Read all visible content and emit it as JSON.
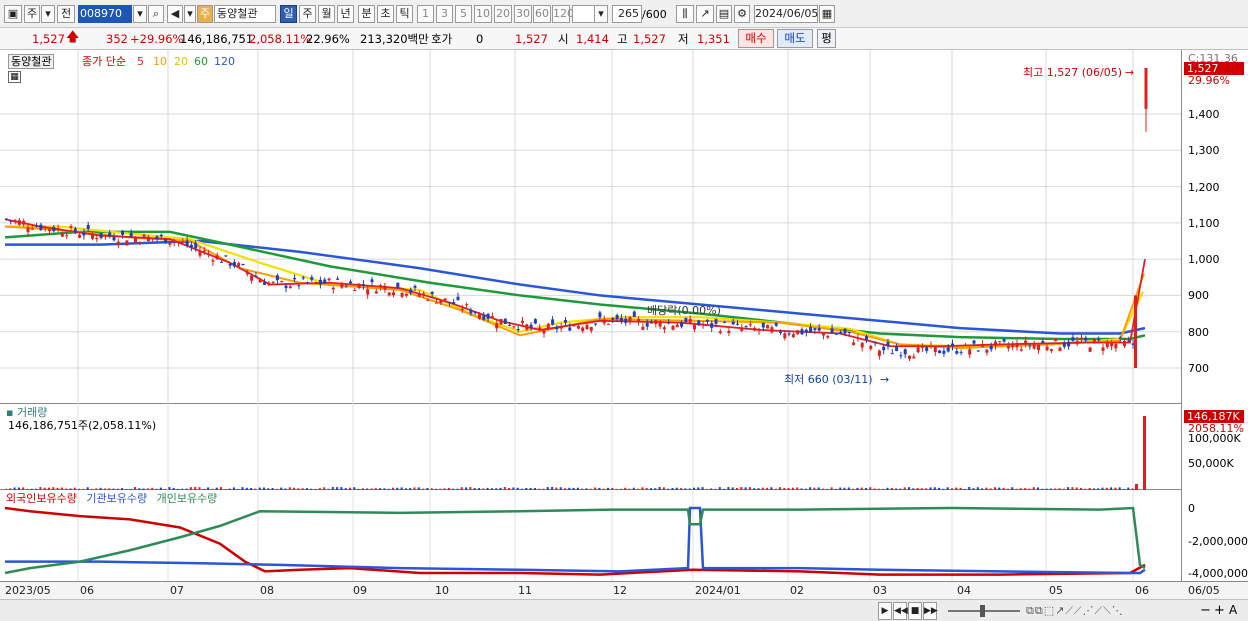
{
  "toolbar": {
    "mode1": "주",
    "mode2": "전",
    "code": "008970",
    "market_badge": "주",
    "name": "동양철관",
    "periods": [
      "일",
      "주",
      "월",
      "년",
      "분",
      "초",
      "틱"
    ],
    "intervals": [
      "1",
      "3",
      "5",
      "10",
      "20",
      "30",
      "60",
      "120"
    ],
    "count": "265",
    "count_max": "/600",
    "date": "2024/06/05"
  },
  "infobar": {
    "price": "1,527",
    "change": "352",
    "change_pct": "+29.96%",
    "volume": "146,186,751",
    "volume_ratio": "2,058.11%",
    "turnover": "22.96%",
    "amount": "213,320백만",
    "hoga_label": "호가",
    "hoga_value": "0",
    "hoga_price": "1,527",
    "open_label": "시",
    "open": "1,414",
    "high_label": "고",
    "high": "1,527",
    "low_label": "저",
    "low": "1,351",
    "buy": "매수",
    "sell": "매도",
    "eval": "평"
  },
  "price_pane": {
    "legend_name": "동양철관",
    "legend_title": "종가 단순",
    "ma": [
      {
        "label": "5",
        "color": "#e02020"
      },
      {
        "label": "10",
        "color": "#ff9c00"
      },
      {
        "label": "20",
        "color": "#f2e000"
      },
      {
        "label": "60",
        "color": "#1f9a3a"
      },
      {
        "label": "120",
        "color": "#2a56d8"
      }
    ],
    "y_ticks": [
      "1,400",
      "1,300",
      "1,200",
      "1,100",
      "1,000",
      "900",
      "800",
      "700"
    ],
    "top_tag": "C:131.36",
    "price_tag": "1,527",
    "pct_tag": "29.96%",
    "high_note": "최고 1,527 (06/05)",
    "low_note": "최저 660 (03/11)",
    "dividend_note": "배당락(0.00%)"
  },
  "volume_pane": {
    "title": "거래량",
    "subtitle": "146,186,751주(2,058.11%)",
    "tag": "146,187K",
    "tag2": "2058.11%",
    "y_ticks": [
      "100,000K",
      "50,000K"
    ]
  },
  "holdings_pane": {
    "legend": [
      {
        "label": "외국인보유수량",
        "color": "#d00000"
      },
      {
        "label": "기관보유수량",
        "color": "#2a56d8"
      },
      {
        "label": "개인보유수량",
        "color": "#2e8b57"
      }
    ],
    "y_ticks": [
      "0",
      "-2,000,000",
      "-4,000,000"
    ]
  },
  "x_axis": [
    "2023/05",
    "06",
    "07",
    "08",
    "09",
    "10",
    "11",
    "12",
    "2024/01",
    "02",
    "03",
    "04",
    "05",
    "06",
    "06/05"
  ]
}
